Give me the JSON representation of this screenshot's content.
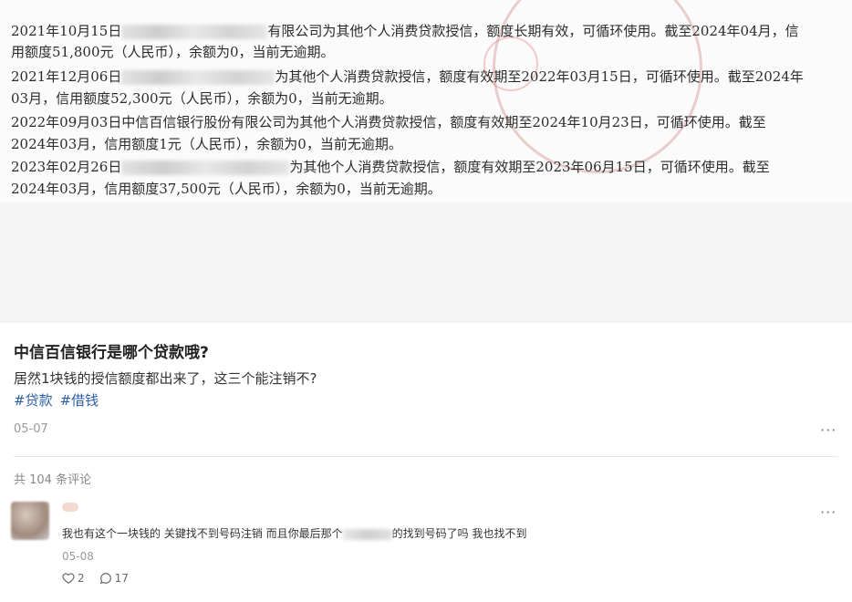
{
  "document_image": {
    "lines": [
      {
        "prefix": "2021年10月15日",
        "suffix": "有限公司为其他个人消费贷款授信，额度长期有效，可循环使用。截至2024年04月，信"
      },
      {
        "prefix": "用额度51,800元（人民币），余额为0，当前无逾期。",
        "suffix": ""
      },
      {
        "prefix": "2021年12月06日",
        "suffix": "为其他个人消费贷款授信，额度有效期至2022年03月15日，可循环使用。截至2024年"
      },
      {
        "prefix": "03月，信用额度52,300元（人民币），余额为0，当前无逾期。",
        "suffix": ""
      },
      {
        "prefix": "2022年09月03日中信百信银行股份有限公司为其他个人消费贷款授信，额度有效期至2024年10月23日，可循环使用。截至",
        "suffix": ""
      },
      {
        "prefix": "2024年03月，信用额度1元（人民币），余额为0，当前无逾期。",
        "suffix": ""
      },
      {
        "prefix": "2023年02月26日",
        "suffix": "为其他个人消费贷款授信，额度有效期至2023年06月15日，可循环使用。截至"
      },
      {
        "prefix": "2024年03月，信用额度37,500元（人民币），余额为0，当前无逾期。",
        "suffix": ""
      }
    ]
  },
  "post": {
    "title": "中信百信银行是哪个贷款哦?",
    "body": "居然1块钱的授信额度都出来了，这三个能注销不?",
    "tags": [
      "#贷款",
      "#借钱"
    ],
    "date": "05-07",
    "more_icon": "more-horizontal-icon",
    "more_glyph": "···"
  },
  "comments_section": {
    "count_label": "共 104 条评论"
  },
  "comment": {
    "text_before": "我也有这个一块钱的 关键找不到号码注销 而且你最后那个",
    "text_after": "的找到号码了吗 我也找不到",
    "date": "05-08",
    "likes": "2",
    "replies": "17",
    "more_glyph": "···"
  },
  "colors": {
    "tag": "#2c5fa8",
    "muted": "#999999",
    "band": "#f5f5f5"
  }
}
